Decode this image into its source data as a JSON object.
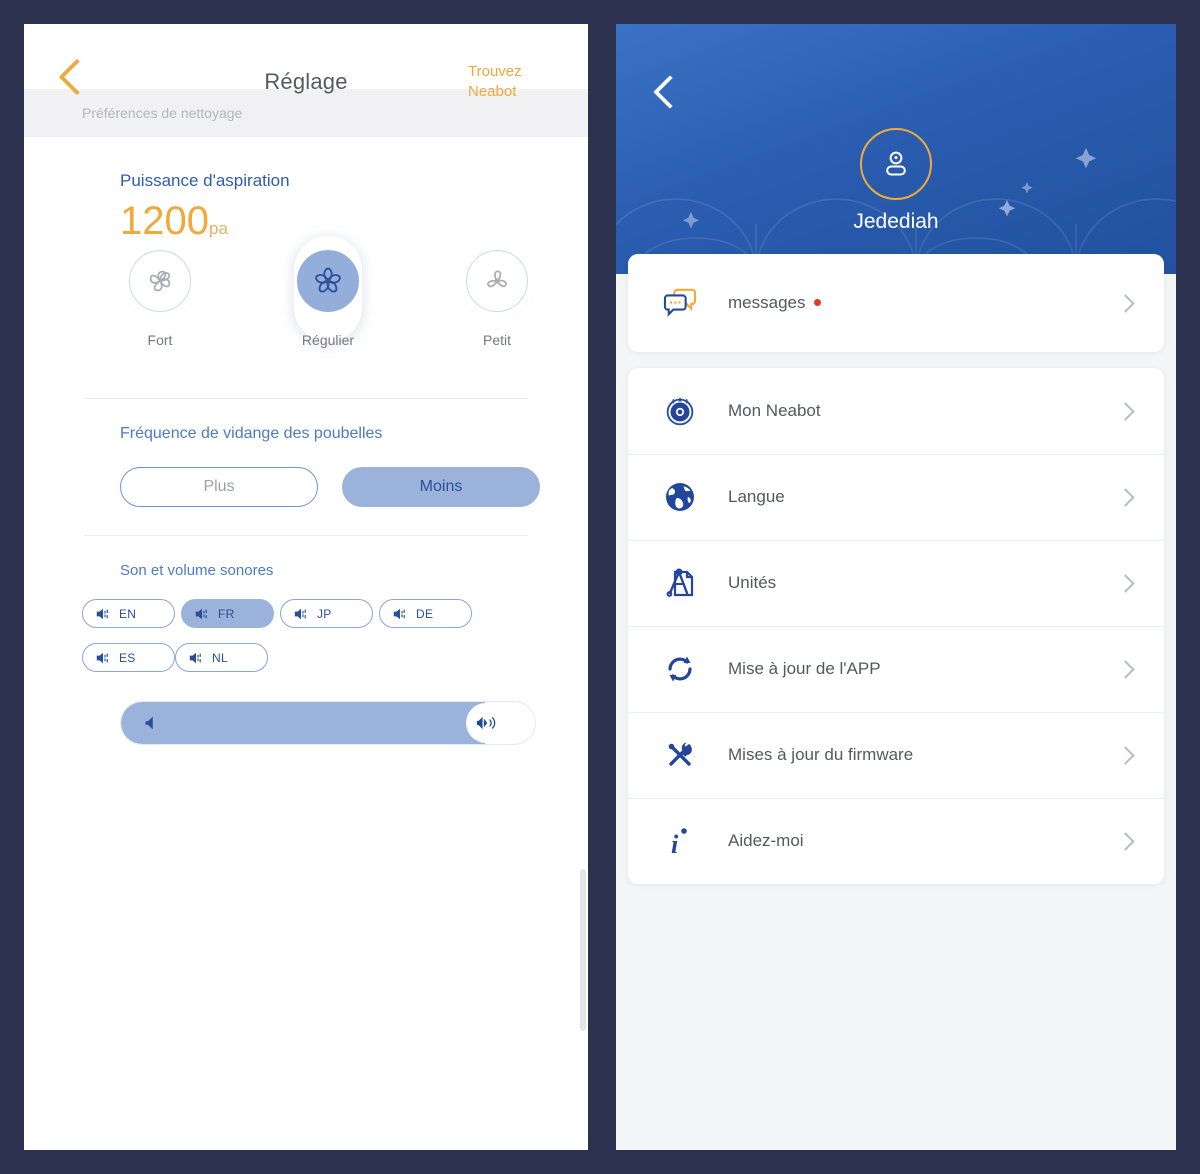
{
  "background_color": "#2d3150",
  "left_panel": {
    "navbar": {
      "back_icon": "chevron-left-icon",
      "title": "Réglage",
      "action_label": "Trouvez Neabot",
      "accent_color": "#f0a93c"
    },
    "section_bar_label": "Préférences de nettoyage",
    "suction": {
      "heading": "Puissance d'aspiration",
      "value": "1200",
      "unit": "pa",
      "options": [
        {
          "label": "Fort",
          "icon": "fan-turbine-icon",
          "selected": false
        },
        {
          "label": "Régulier",
          "icon": "fan-five-blade-icon",
          "selected": true
        },
        {
          "label": "Petit",
          "icon": "fan-propeller-icon",
          "selected": false
        }
      ]
    },
    "trash_frequency": {
      "heading": "Fréquence de vidange des poubelles",
      "options": [
        {
          "label": "Plus",
          "selected": false
        },
        {
          "label": "Moins",
          "selected": true
        }
      ]
    },
    "sound": {
      "heading": "Son et volume sonores",
      "languages": [
        {
          "code": "EN",
          "selected": false
        },
        {
          "code": "FR",
          "selected": true
        },
        {
          "code": "JP",
          "selected": false
        },
        {
          "code": "DE",
          "selected": false
        },
        {
          "code": "ES",
          "selected": false
        },
        {
          "code": "NL",
          "selected": false
        }
      ],
      "volume_percent": 88
    }
  },
  "right_panel": {
    "header": {
      "back_icon": "chevron-left-icon",
      "avatar_icon": "user-avatar-icon",
      "username": "Jedediah",
      "avatar_ring_color": "#f0a93c"
    },
    "messages_card": {
      "label": "messages",
      "icon": "chat-bubbles-icon",
      "badge": true,
      "badge_color": "#e03a2f",
      "chevron": "chevron-right-icon"
    },
    "menu_items": [
      {
        "label": "Mon Neabot",
        "icon": "robot-vacuum-icon"
      },
      {
        "label": "Langue",
        "icon": "globe-icon"
      },
      {
        "label": "Unités",
        "icon": "compass-ruler-icon"
      },
      {
        "label": "Mise à jour de l'APP",
        "icon": "refresh-cycle-icon"
      },
      {
        "label": "Mises à jour du firmware",
        "icon": "wrench-screwdriver-icon"
      },
      {
        "label": "Aidez-moi",
        "icon": "info-italic-icon"
      }
    ]
  }
}
